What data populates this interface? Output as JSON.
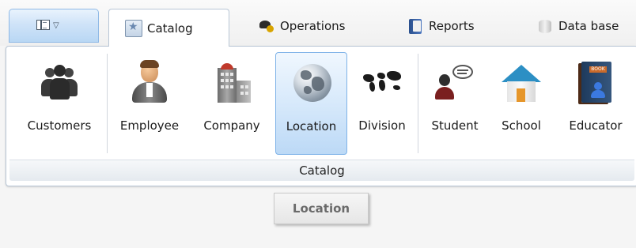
{
  "tabs": [
    {
      "label": "Catalog",
      "icon": "catalog-icon",
      "active": true
    },
    {
      "label": "Operations",
      "icon": "operations-icon",
      "active": false
    },
    {
      "label": "Reports",
      "icon": "reports-icon",
      "active": false
    },
    {
      "label": "Data base",
      "icon": "database-icon",
      "active": false
    }
  ],
  "ribbon": {
    "buttons": [
      {
        "label": "Customers",
        "icon": "customers-icon"
      },
      {
        "label": "Employee",
        "icon": "employee-icon"
      },
      {
        "label": "Company",
        "icon": "company-icon"
      },
      {
        "label": "Location",
        "icon": "globe-icon",
        "selected": true
      },
      {
        "label": "Division",
        "icon": "world-map-icon"
      },
      {
        "label": "Student",
        "icon": "student-icon"
      },
      {
        "label": "School",
        "icon": "school-icon"
      },
      {
        "label": "Educator",
        "icon": "educator-icon"
      }
    ],
    "group_caption": "Catalog"
  },
  "tooltip": {
    "text": "Location"
  },
  "colors": {
    "selected_blue": "#bcd9f6",
    "school_roof": "#2c8fc4",
    "roof_red": "#c0392b"
  }
}
